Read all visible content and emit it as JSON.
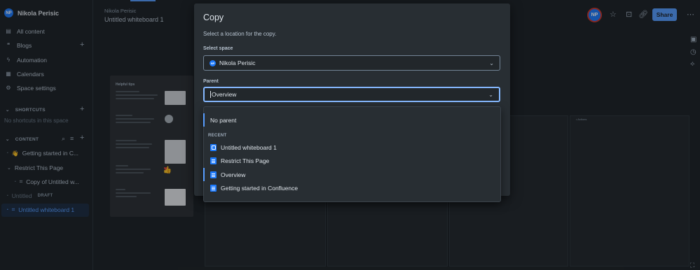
{
  "sidebar": {
    "space": {
      "initials": "NP",
      "name": "Nikola Perisic"
    },
    "nav": [
      {
        "label": "All content",
        "icon": "all-content-icon"
      },
      {
        "label": "Blogs",
        "icon": "blog-icon"
      },
      {
        "label": "Automation",
        "icon": "automation-icon"
      },
      {
        "label": "Calendars",
        "icon": "calendar-icon"
      },
      {
        "label": "Space settings",
        "icon": "gear-icon"
      }
    ],
    "shortcuts_label": "SHORTCUTS",
    "no_shortcuts": "No shortcuts in this space",
    "content_label": "CONTENT",
    "tree": [
      {
        "label": "Getting started in C...",
        "icon": "wave-emoji"
      },
      {
        "label": "Restrict This Page"
      },
      {
        "label": "Copy of Untitled w..."
      },
      {
        "label": "Untitled",
        "badge": "DRAFT"
      },
      {
        "label": "Untitled whiteboard 1"
      }
    ]
  },
  "header": {
    "breadcrumb": "Nikola Perisic",
    "title": "Untitled whiteboard 1",
    "avatar_initials": "NP",
    "share_label": "Share"
  },
  "canvas": {
    "tips_title": "Helpful tips",
    "column_note": "• Actions"
  },
  "modal": {
    "title": "Copy",
    "description": "Select a location for the copy.",
    "space_label": "Select space",
    "space_value": "Nikola Perisic",
    "space_initials": "NP",
    "parent_label": "Parent",
    "parent_value": "Overview",
    "dropdown": {
      "no_parent": "No parent",
      "recent_label": "RECENT",
      "items": [
        {
          "label": "Untitled whiteboard 1",
          "icon": "whiteboard-icon"
        },
        {
          "label": "Restrict This Page",
          "icon": "page-icon"
        },
        {
          "label": "Overview",
          "icon": "page-icon"
        },
        {
          "label": "Getting started in Confluence",
          "icon": "page-icon"
        }
      ]
    }
  }
}
